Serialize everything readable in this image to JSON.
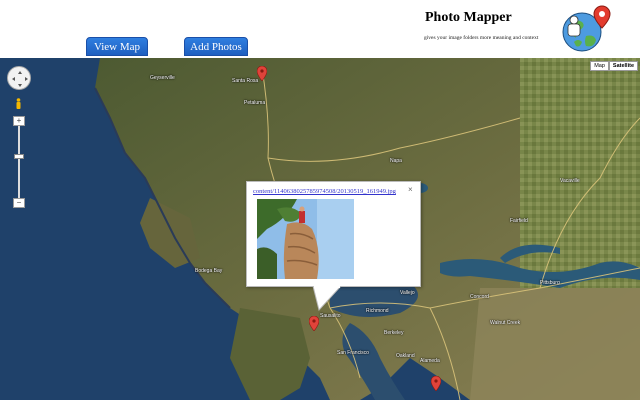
{
  "nav": {
    "view_map": "View Map",
    "add_photos": "Add Photos"
  },
  "brand": {
    "title": "Photo Mapper",
    "tagline": "gives your image folders more meaning and context",
    "logo_icon": "globe-with-map-pin-icon"
  },
  "map": {
    "map_type": {
      "map": "Map",
      "satellite": "Satellite",
      "selected": "Satellite"
    },
    "controls": {
      "zoom_in": "+",
      "zoom_out": "−",
      "pan_icon": "pan-control-icon",
      "pegman_icon": "street-view-pegman-icon"
    },
    "places": [
      "Santa Rosa",
      "Geyserville",
      "Petaluma",
      "Napa",
      "Vallejo",
      "Richmond",
      "Berkeley",
      "Oakland",
      "San Francisco",
      "Sausalito",
      "Concord",
      "Fairfield",
      "Vacaville",
      "Bodega Bay",
      "Alameda",
      "Walnut Creek",
      "Pittsburg"
    ],
    "marker_color": "#e0433a"
  },
  "popup": {
    "link": "content/1140638025785974508/20130519_161949.jpg",
    "close": "×",
    "photo_icon": "photo-thumbnail-icon"
  },
  "colors": {
    "button": "#2f7fe0",
    "ocean": "#1e3f66",
    "land": "#5c6b3c",
    "link": "#3333cc"
  }
}
